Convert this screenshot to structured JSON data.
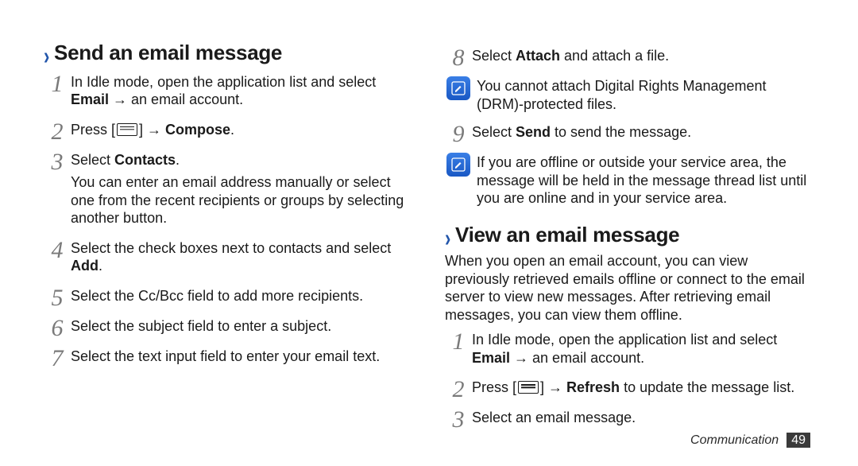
{
  "left": {
    "heading": "Send an email message",
    "steps": [
      {
        "num": "1",
        "lines": [
          "In Idle mode, open the application list and select <b>Email</b> → an email account."
        ]
      },
      {
        "num": "2",
        "lines": [
          "Press [|MENU|] → <b>Compose</b>."
        ]
      },
      {
        "num": "3",
        "lines": [
          "Select <b>Contacts</b>.",
          "You can enter an email address manually or select one from the recent recipients or groups by selecting another button."
        ]
      },
      {
        "num": "4",
        "lines": [
          "Select the check boxes next to contacts and select <b>Add</b>."
        ]
      },
      {
        "num": "5",
        "lines": [
          "Select the Cc/Bcc field to add more recipients."
        ]
      },
      {
        "num": "6",
        "lines": [
          "Select the subject field to enter a subject."
        ]
      },
      {
        "num": "7",
        "lines": [
          "Select the text input field to enter your email text."
        ]
      }
    ]
  },
  "right": {
    "topSteps": [
      {
        "num": "8",
        "lines": [
          "Select <b>Attach</b> and attach a file."
        ]
      }
    ],
    "note1": [
      "You cannot attach Digital Rights Management (DRM)-protected files."
    ],
    "step9": {
      "num": "9",
      "lines": [
        "Select <b>Send</b> to send the message."
      ]
    },
    "note2": [
      "If you are offline or outside your service area, the message will be held in the message thread list until you are online and in your service area."
    ],
    "heading2": "View an email message",
    "intro2": "When you open an email account, you can view previously retrieved emails offline or connect to the email server to view new messages. After retrieving email messages, you can view them offline.",
    "steps2": [
      {
        "num": "1",
        "lines": [
          "In Idle mode, open the application list and select <b>Email</b> → an email account."
        ]
      },
      {
        "num": "2",
        "lines": [
          "Press [|MENU|] → <b>Refresh</b> to update the message list."
        ]
      },
      {
        "num": "3",
        "lines": [
          "Select an email message."
        ]
      }
    ]
  },
  "footer": {
    "section": "Communication",
    "page": "49"
  }
}
